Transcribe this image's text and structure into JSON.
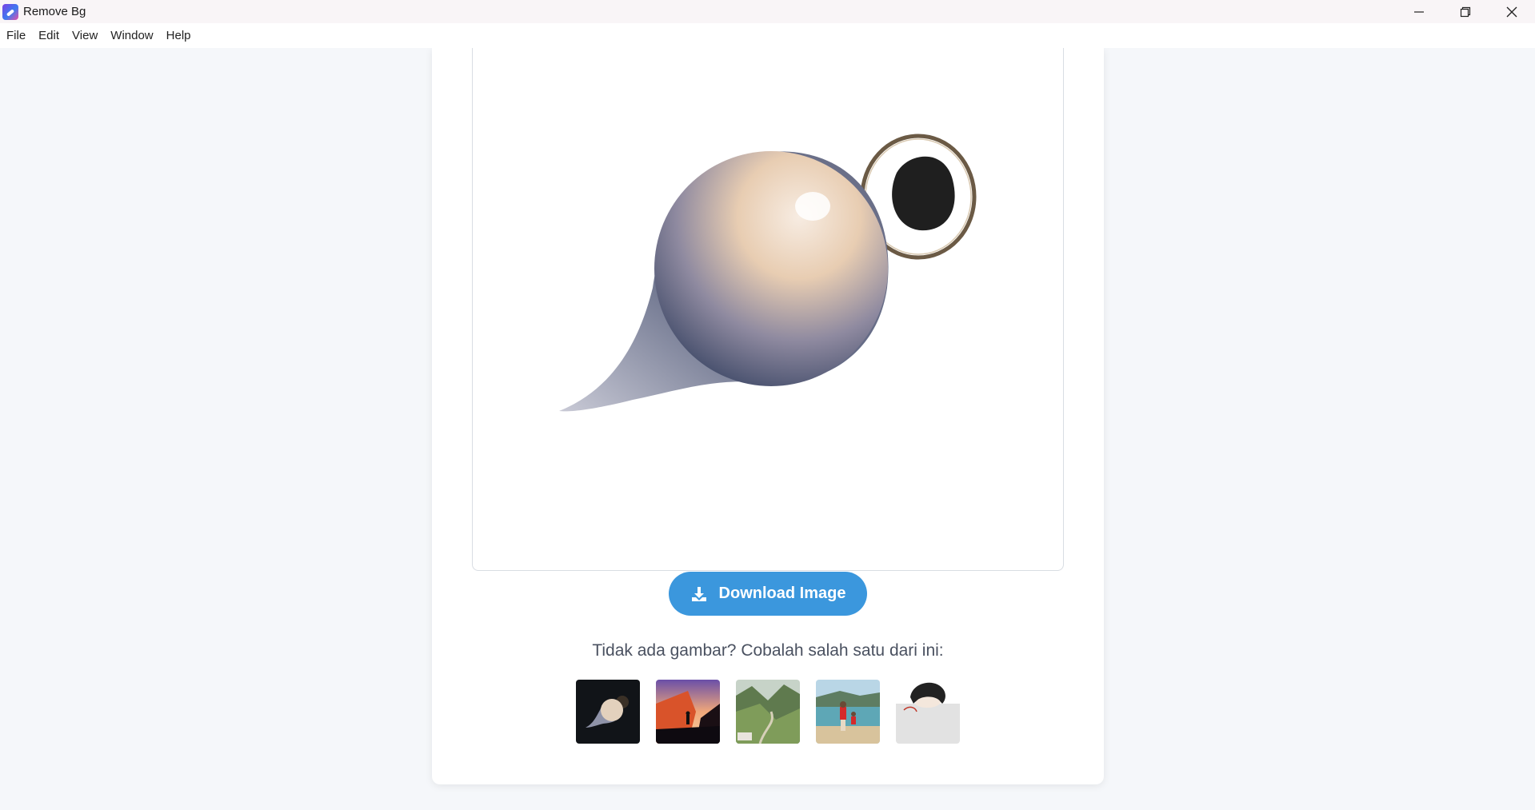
{
  "window": {
    "title": "Remove Bg",
    "controls": [
      "minimize-icon",
      "restore-icon",
      "close-icon"
    ]
  },
  "menu": {
    "items": [
      "File",
      "Edit",
      "View",
      "Window",
      "Help"
    ]
  },
  "main": {
    "download_label": "Download Image",
    "download_icon": "download-icon",
    "prompt_text": "Tidak ada gambar? Cobalah salah satu dari ini:",
    "samples": [
      {
        "name": "sample-ornament",
        "description": "ornament on black"
      },
      {
        "name": "sample-canyon",
        "description": "person at sunset canyon"
      },
      {
        "name": "sample-valley",
        "description": "green mountain valley"
      },
      {
        "name": "sample-beach",
        "description": "family on beach"
      },
      {
        "name": "sample-sketch",
        "description": "drawing of a person"
      }
    ]
  },
  "colors": {
    "accent": "#3b97dd",
    "background": "#f5f7fa",
    "card": "#ffffff",
    "text_muted": "#4a5160"
  }
}
